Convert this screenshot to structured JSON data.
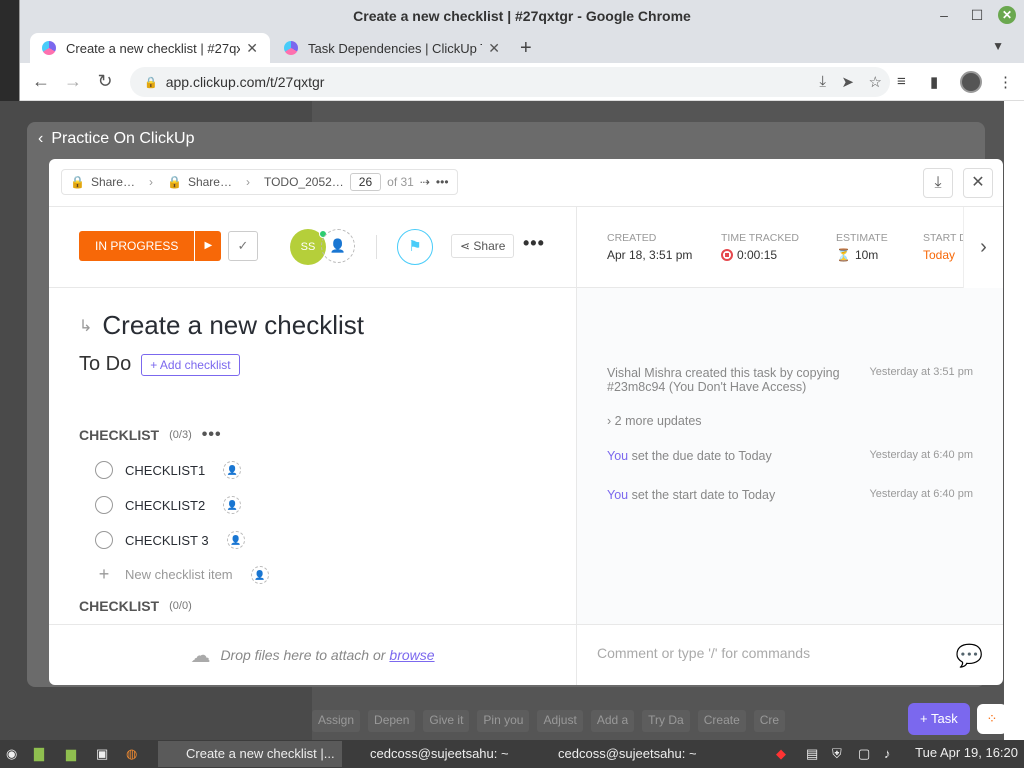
{
  "window": {
    "title": "Create a new checklist | #27qxtgr - Google Chrome"
  },
  "tabs": [
    {
      "label": "Create a new checklist | #27qxtgr"
    },
    {
      "label": "Task Dependencies | ClickUp Tasks"
    }
  ],
  "browser": {
    "url": "app.clickup.com/t/27qxtgr"
  },
  "modal": {
    "back_label": "Practice On ClickUp",
    "breadcrumbs": [
      "Share…",
      "Share…",
      "TODO_2052…"
    ],
    "position": "26",
    "of_total": "of 31"
  },
  "task": {
    "status": "IN PROGRESS",
    "assignee_initials": "SS",
    "share_label": "Share",
    "title": "Create a new checklist",
    "list_name": "To Do",
    "add_checklist": "+ Add checklist"
  },
  "meta": {
    "created_label": "CREATED",
    "created_value": "Apr 18, 3:51 pm",
    "time_label": "TIME TRACKED",
    "time_value": "0:00:15",
    "estimate_label": "ESTIMATE",
    "estimate_value": "10m",
    "start_label": "START D",
    "start_value": "Today"
  },
  "checklists": [
    {
      "heading": "CHECKLIST",
      "count": "(0/3)",
      "items": [
        "CHECKLIST1",
        "CHECKLIST2",
        "CHECKLIST 3"
      ],
      "new_item_placeholder": "New checklist item"
    },
    {
      "heading": "CHECKLIST",
      "count": "(0/0)"
    }
  ],
  "activity": [
    {
      "text": "Vishal Mishra created this task by copying #23m8c94 (You Don't Have Access)",
      "time": "Yesterday at 3:51 pm"
    },
    {
      "text": "2 more updates"
    },
    {
      "who": "You",
      "text": "set the due date to Today",
      "time": "Yesterday at 6:40 pm"
    },
    {
      "who": "You",
      "text": "set the start date to Today",
      "time": "Yesterday at 6:40 pm"
    }
  ],
  "footer": {
    "drop_text": "Drop files here to attach or",
    "browse": "browse",
    "comment_placeholder": "Comment or type '/' for commands"
  },
  "floating": {
    "task_button": "Task"
  },
  "page_bottom_chips": [
    "Assign",
    "Depen",
    "Give it",
    "Pin you",
    "Adjust",
    "Add a",
    "Try Da",
    "Create",
    "Cre"
  ],
  "taskbar": {
    "active_window": "Create a new checklist |...",
    "terminal1": "cedcoss@sujeetsahu: ~",
    "terminal2": "cedcoss@sujeetsahu: ~",
    "clock": "Tue Apr 19, 16:20"
  },
  "colors": {
    "accent": "#7b68ee",
    "status": "#f76808",
    "flag": "#49ccf9"
  }
}
